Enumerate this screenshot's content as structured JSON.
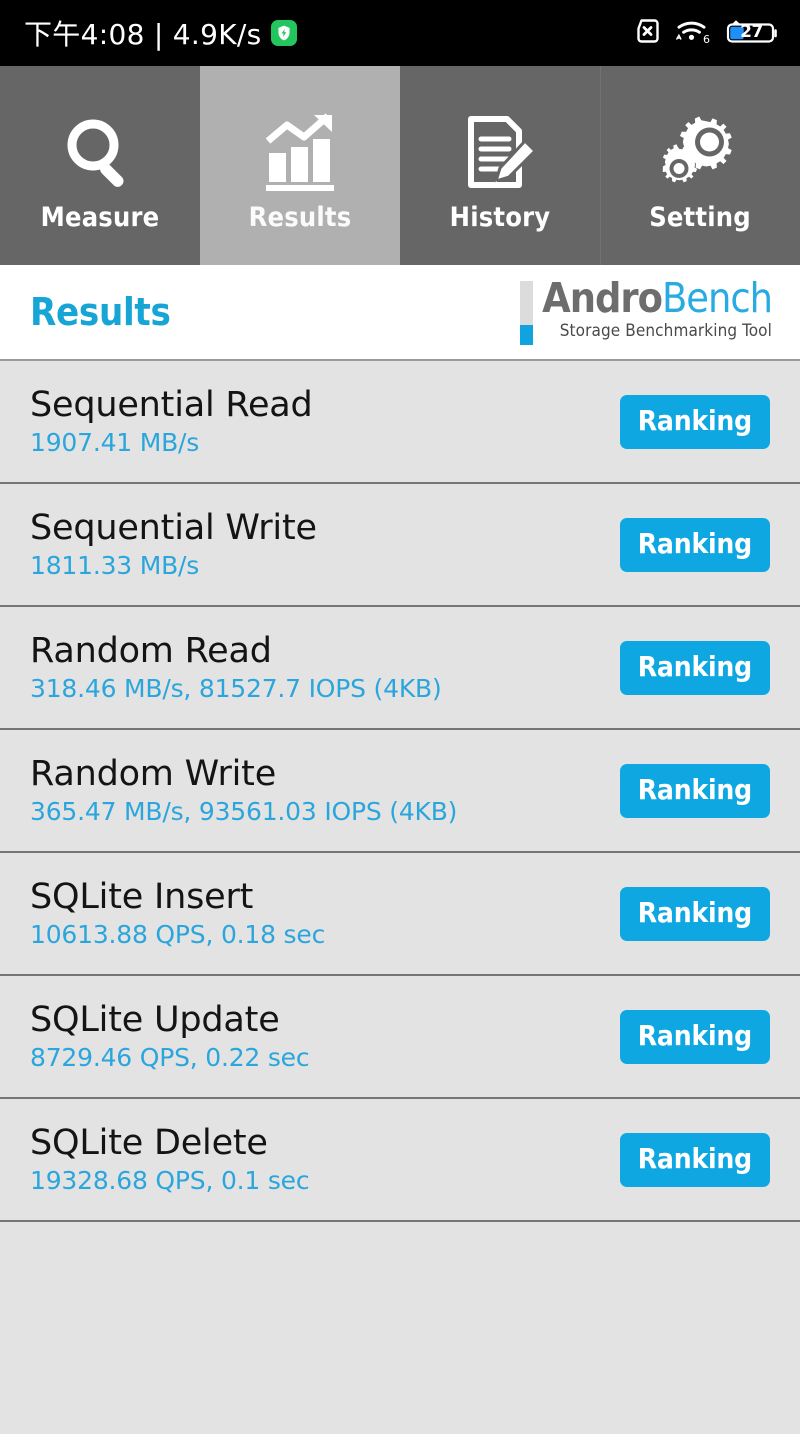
{
  "statusbar": {
    "clock": "下午4:08 | 4.9K/s",
    "shield_icon": "shield-green-icon",
    "sim_icon": "sim-card-off-icon",
    "wifi_icon": "wifi-icon",
    "wifi_generation": "6",
    "battery_icon": "battery-icon",
    "battery_level": "27"
  },
  "tabs": [
    {
      "label": "Measure",
      "icon": "magnifier-icon",
      "selected": false
    },
    {
      "label": "Results",
      "icon": "bar-chart-up-icon",
      "selected": true
    },
    {
      "label": "History",
      "icon": "document-pencil-icon",
      "selected": false
    },
    {
      "label": "Setting",
      "icon": "gears-icon",
      "selected": false
    }
  ],
  "header": {
    "title": "Results",
    "logo_andro": "Andro",
    "logo_bench": "Bench",
    "logo_subtitle": "Storage Benchmarking Tool"
  },
  "results": {
    "ranking_label": "Ranking",
    "rows": [
      {
        "title": "Sequential Read",
        "value": "1907.41 MB/s"
      },
      {
        "title": "Sequential Write",
        "value": "1811.33 MB/s"
      },
      {
        "title": "Random Read",
        "value": "318.46 MB/s, 81527.7 IOPS (4KB)"
      },
      {
        "title": "Random Write",
        "value": "365.47 MB/s, 93561.03 IOPS (4KB)"
      },
      {
        "title": "SQLite Insert",
        "value": "10613.88 QPS, 0.18 sec"
      },
      {
        "title": "SQLite Update",
        "value": "8729.46 QPS, 0.22 sec"
      },
      {
        "title": "SQLite Delete",
        "value": "19328.68 QPS, 0.1 sec"
      }
    ]
  },
  "colors": {
    "accent_cyan": "#0fa7e2",
    "value_cyan": "#2ba6dd",
    "title_cyan": "#17a5d6",
    "tab_unselected": "#666666",
    "tab_selected": "#b0b0b0",
    "row_background": "#e3e3e3",
    "statusbar_background": "#000000",
    "shield_green": "#22c55e"
  }
}
